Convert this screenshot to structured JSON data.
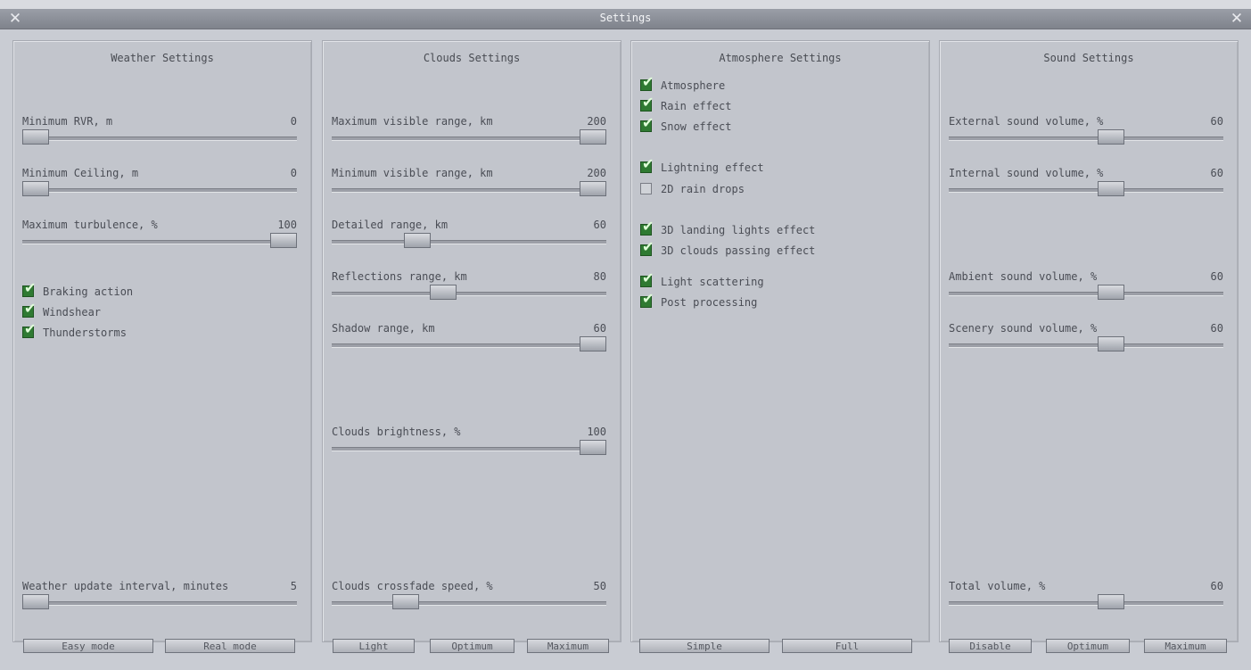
{
  "window": {
    "title": "Settings"
  },
  "weather": {
    "title": "Weather Settings",
    "sliders": [
      {
        "label": "Minimum RVR, m",
        "value": "0"
      },
      {
        "label": "Minimum Ceiling, m",
        "value": "0"
      },
      {
        "label": "Maximum turbulence, %",
        "value": "100"
      },
      {
        "label": "Weather update interval, minutes",
        "value": "5"
      }
    ],
    "checks": [
      {
        "label": "Braking action",
        "checked": true
      },
      {
        "label": "Windshear",
        "checked": true
      },
      {
        "label": "Thunderstorms",
        "checked": true
      }
    ],
    "buttons": [
      "Easy mode",
      "Real mode"
    ]
  },
  "clouds": {
    "title": "Clouds Settings",
    "sliders": [
      {
        "label": "Maximum visible range, km",
        "value": "200"
      },
      {
        "label": "Minimum visible range, km",
        "value": "200"
      },
      {
        "label": "Detailed range, km",
        "value": "60"
      },
      {
        "label": "Reflections range, km",
        "value": "80"
      },
      {
        "label": "Shadow range, km",
        "value": "60"
      },
      {
        "label": "Clouds brightness, %",
        "value": "100"
      },
      {
        "label": "Clouds crossfade speed, %",
        "value": "50"
      }
    ],
    "buttons": [
      "Light",
      "Optimum",
      "Maximum"
    ]
  },
  "atmosphere": {
    "title": "Atmosphere Settings",
    "checks": [
      {
        "label": "Atmosphere",
        "checked": true
      },
      {
        "label": "Rain effect",
        "checked": true
      },
      {
        "label": "Snow effect",
        "checked": true
      },
      {
        "label": "Lightning effect",
        "checked": true
      },
      {
        "label": "2D rain drops",
        "checked": false
      },
      {
        "label": "3D landing lights effect",
        "checked": true
      },
      {
        "label": "3D clouds passing effect",
        "checked": true
      },
      {
        "label": "Light scattering",
        "checked": true
      },
      {
        "label": "Post processing",
        "checked": true
      }
    ],
    "buttons": [
      "Simple",
      "Full"
    ]
  },
  "sound": {
    "title": "Sound Settings",
    "sliders": [
      {
        "label": "External sound volume, %",
        "value": "60"
      },
      {
        "label": "Internal sound volume, %",
        "value": "60"
      },
      {
        "label": "Ambient sound volume, %",
        "value": "60"
      },
      {
        "label": "Scenery sound volume, %",
        "value": "60"
      },
      {
        "label": "Total volume, %",
        "value": "60"
      }
    ],
    "buttons": [
      "Disable",
      "Optimum",
      "Maximum"
    ]
  }
}
